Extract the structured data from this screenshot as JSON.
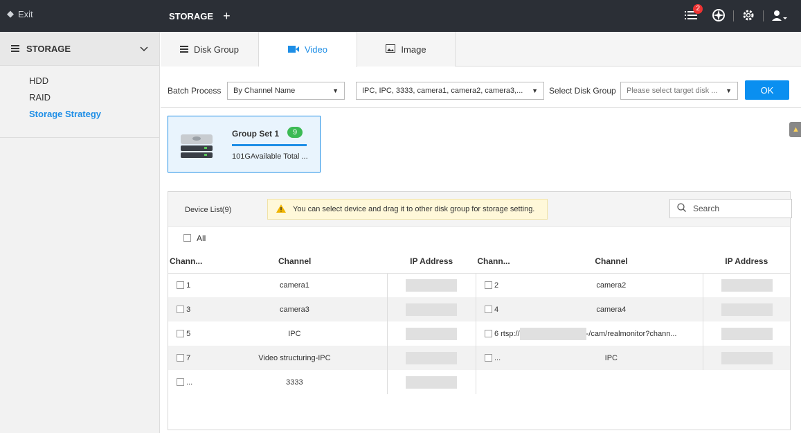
{
  "topbar": {
    "exit_label": "Exit",
    "tab_label": "STORAGE",
    "add_label": "+",
    "notification_count": "2"
  },
  "sidebar": {
    "title": "STORAGE",
    "items": [
      {
        "label": "HDD"
      },
      {
        "label": "RAID"
      },
      {
        "label": "Storage Strategy"
      }
    ]
  },
  "tabs": [
    {
      "label": "Disk Group"
    },
    {
      "label": "Video"
    },
    {
      "label": "Image"
    }
  ],
  "toolbar": {
    "batch_label": "Batch Process",
    "batch_value": "By Channel Name",
    "channels_value": "IPC, IPC, 3333, camera1, camera2, camera3,...",
    "disk_group_label": "Select Disk Group",
    "disk_group_placeholder": "Please select target disk ...",
    "ok_label": "OK"
  },
  "group_card": {
    "name": "Group Set 1",
    "count": "9",
    "capacity_text": "101GAvailable Total ...",
    "usage_fraction": 1.0
  },
  "warning_badge": "76",
  "device_panel": {
    "title": "Device List(9)",
    "tip": "You can select device and drag it to other disk group for storage setting.",
    "search_placeholder": "Search",
    "all_label": "All",
    "headers": [
      "Chann...",
      "Channel",
      "IP Address",
      "Chann...",
      "Channel",
      "IP Address"
    ],
    "rows": [
      {
        "n1": "1",
        "c1": "camera1",
        "n2": "2",
        "c2": "camera2"
      },
      {
        "n1": "3",
        "c1": "camera3",
        "n2": "4",
        "c2": "camera4"
      },
      {
        "n1": "5",
        "c1": "IPC",
        "n2": "6 rtsp://",
        "c2": "-/cam/realmonitor?chann..."
      },
      {
        "n1": "7",
        "c1": "Video structuring-IPC",
        "n2": "...",
        "c2": "IPC"
      },
      {
        "n1": "...",
        "c1": "3333",
        "n2": "",
        "c2": ""
      }
    ]
  },
  "colors": {
    "accent": "#1e8ee6",
    "topbar": "#2b2f36",
    "badge_green": "#3cba54",
    "notification_red": "#e33333"
  }
}
